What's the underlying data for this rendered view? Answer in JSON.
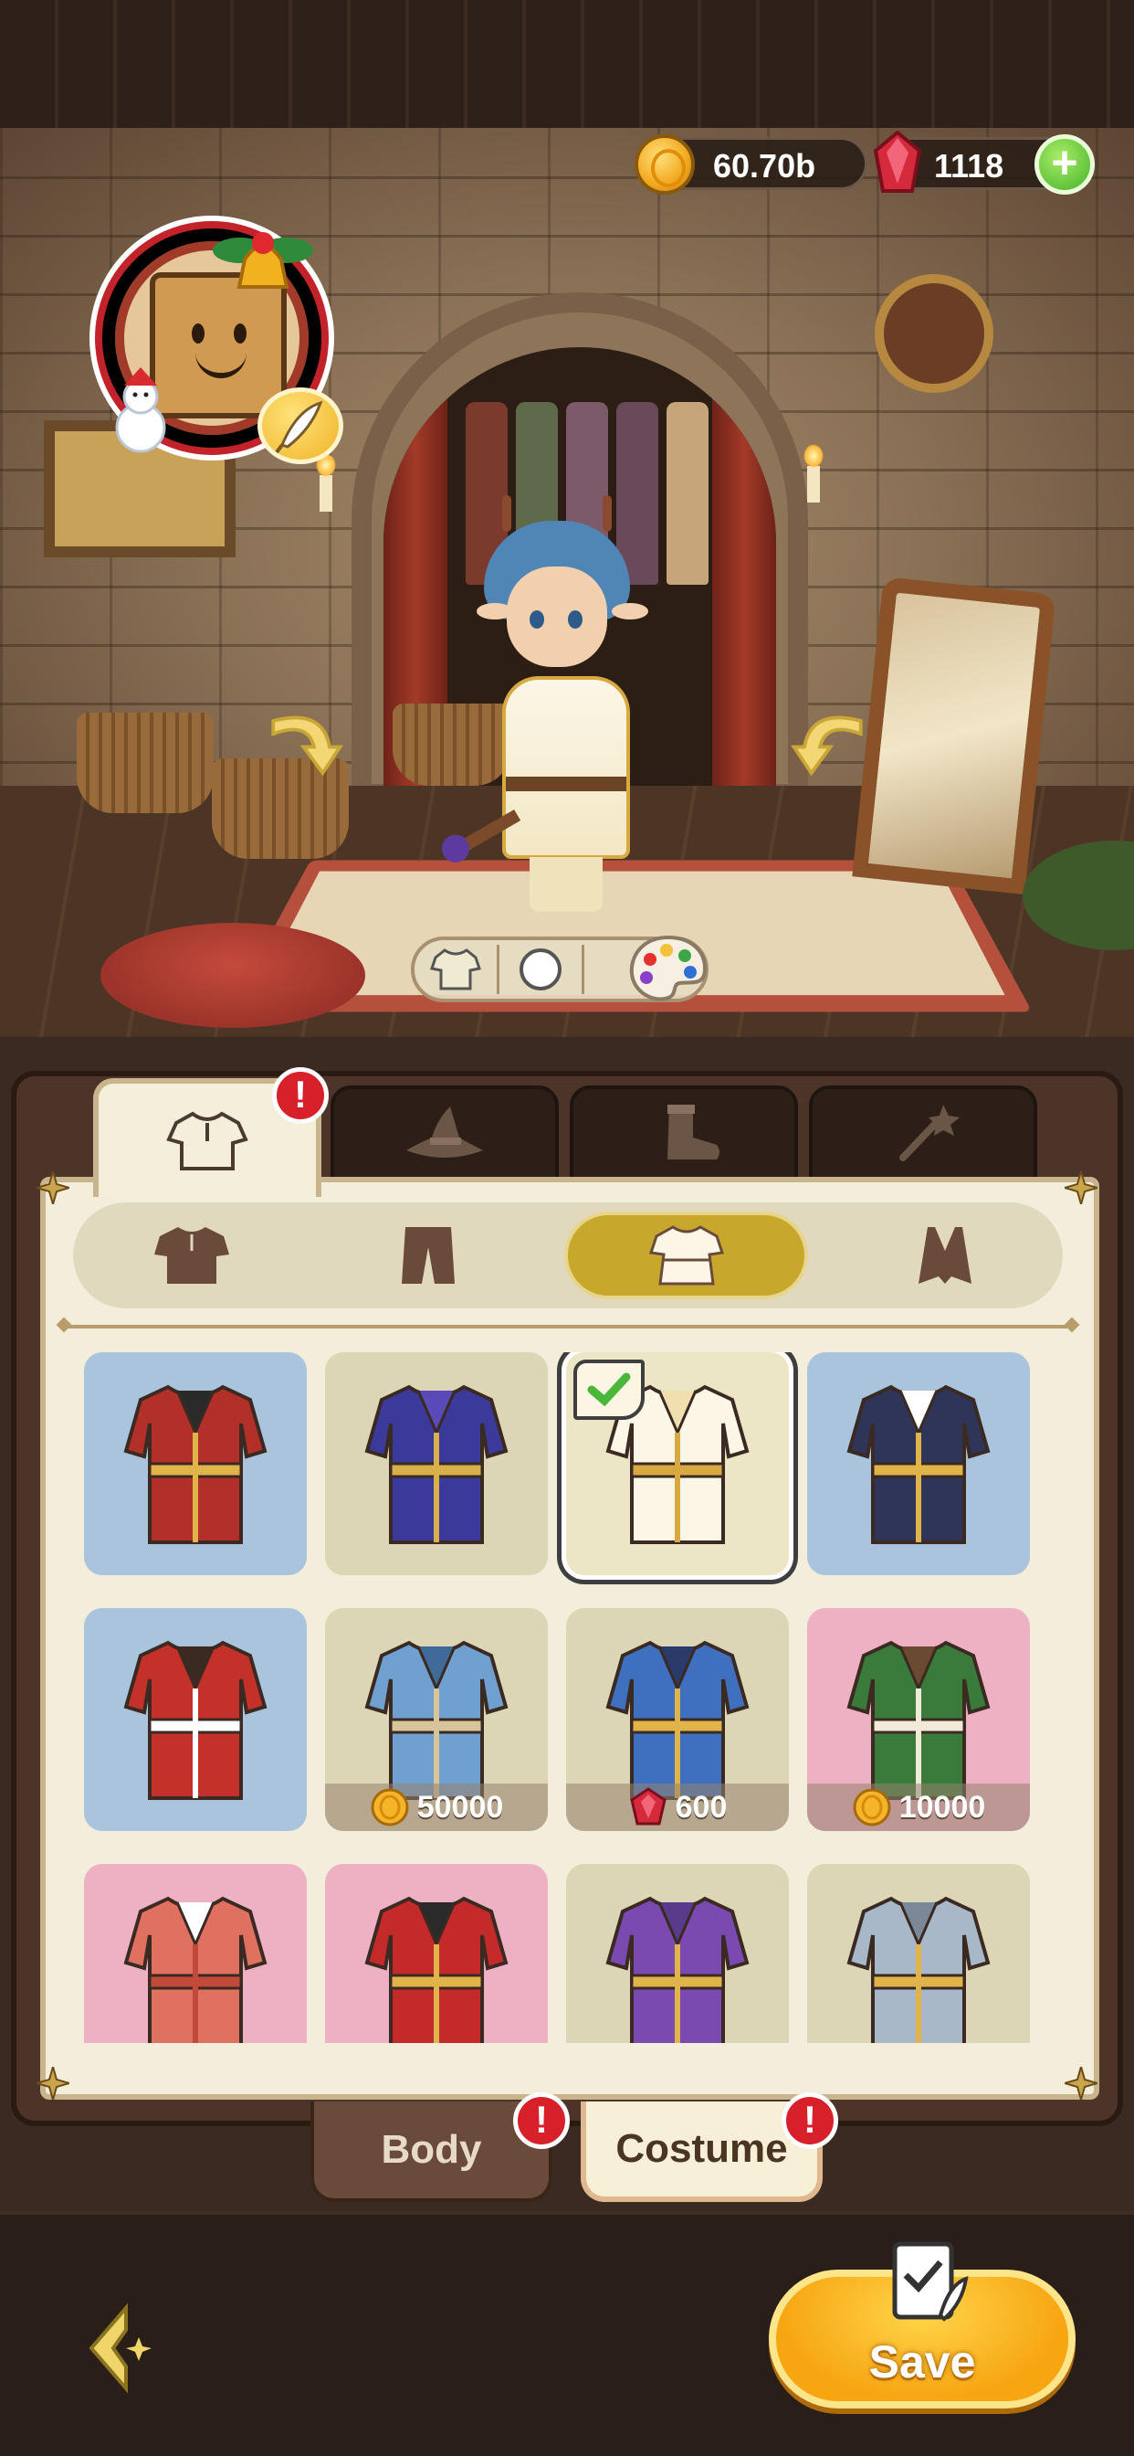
{
  "currency": {
    "gold": "60.70b",
    "gems": "1118"
  },
  "colors": {
    "accent_gold": "#f7a511",
    "selected_subtab": "#c8a82c",
    "alert_red": "#d8202a",
    "card_blue": "#a9c4dc",
    "card_tan": "#ddd6b6",
    "card_pink": "#edb1c3"
  },
  "category_tabs": [
    {
      "icon": "shirt-icon",
      "active": true,
      "alert": true
    },
    {
      "icon": "wizard-hat-icon",
      "active": false
    },
    {
      "icon": "boot-icon",
      "active": false
    },
    {
      "icon": "magic-staff-icon",
      "active": false
    }
  ],
  "sub_tabs": [
    {
      "icon": "tunic-icon",
      "active": false
    },
    {
      "icon": "pants-icon",
      "active": false
    },
    {
      "icon": "robe-icon",
      "active": true
    },
    {
      "icon": "cape-icon",
      "active": false
    }
  ],
  "items": [
    {
      "icon": "red-royal-coat-icon",
      "bg": "blue",
      "owned": true
    },
    {
      "icon": "starry-purple-robe-icon",
      "bg": "tan",
      "owned": true
    },
    {
      "icon": "white-gold-robe-icon",
      "bg": "tan",
      "owned": true,
      "equipped": true
    },
    {
      "icon": "pirate-captain-outfit-icon",
      "bg": "blue",
      "owned": true
    },
    {
      "icon": "red-festive-coat-icon",
      "bg": "blue",
      "owned": true
    },
    {
      "icon": "blue-hooded-robe-icon",
      "bg": "tan",
      "price": "50000",
      "currency": "coin-icon"
    },
    {
      "icon": "blue-gold-robe-icon",
      "bg": "tan",
      "price": "600",
      "currency": "gem-icon"
    },
    {
      "icon": "green-peasant-dress-icon",
      "bg": "pink",
      "price": "10000",
      "currency": "coin-icon"
    },
    {
      "icon": "red-white-dress-icon",
      "bg": "pink"
    },
    {
      "icon": "red-sorceress-gown-icon",
      "bg": "pink"
    },
    {
      "icon": "purple-mage-robe-icon",
      "bg": "tan"
    },
    {
      "icon": "steel-armor-icon",
      "bg": "tan"
    }
  ],
  "mode_tabs": {
    "body": "Body",
    "costume": "Costume"
  },
  "alert_symbol": "!",
  "save_label": "Save",
  "plus_symbol": "+"
}
